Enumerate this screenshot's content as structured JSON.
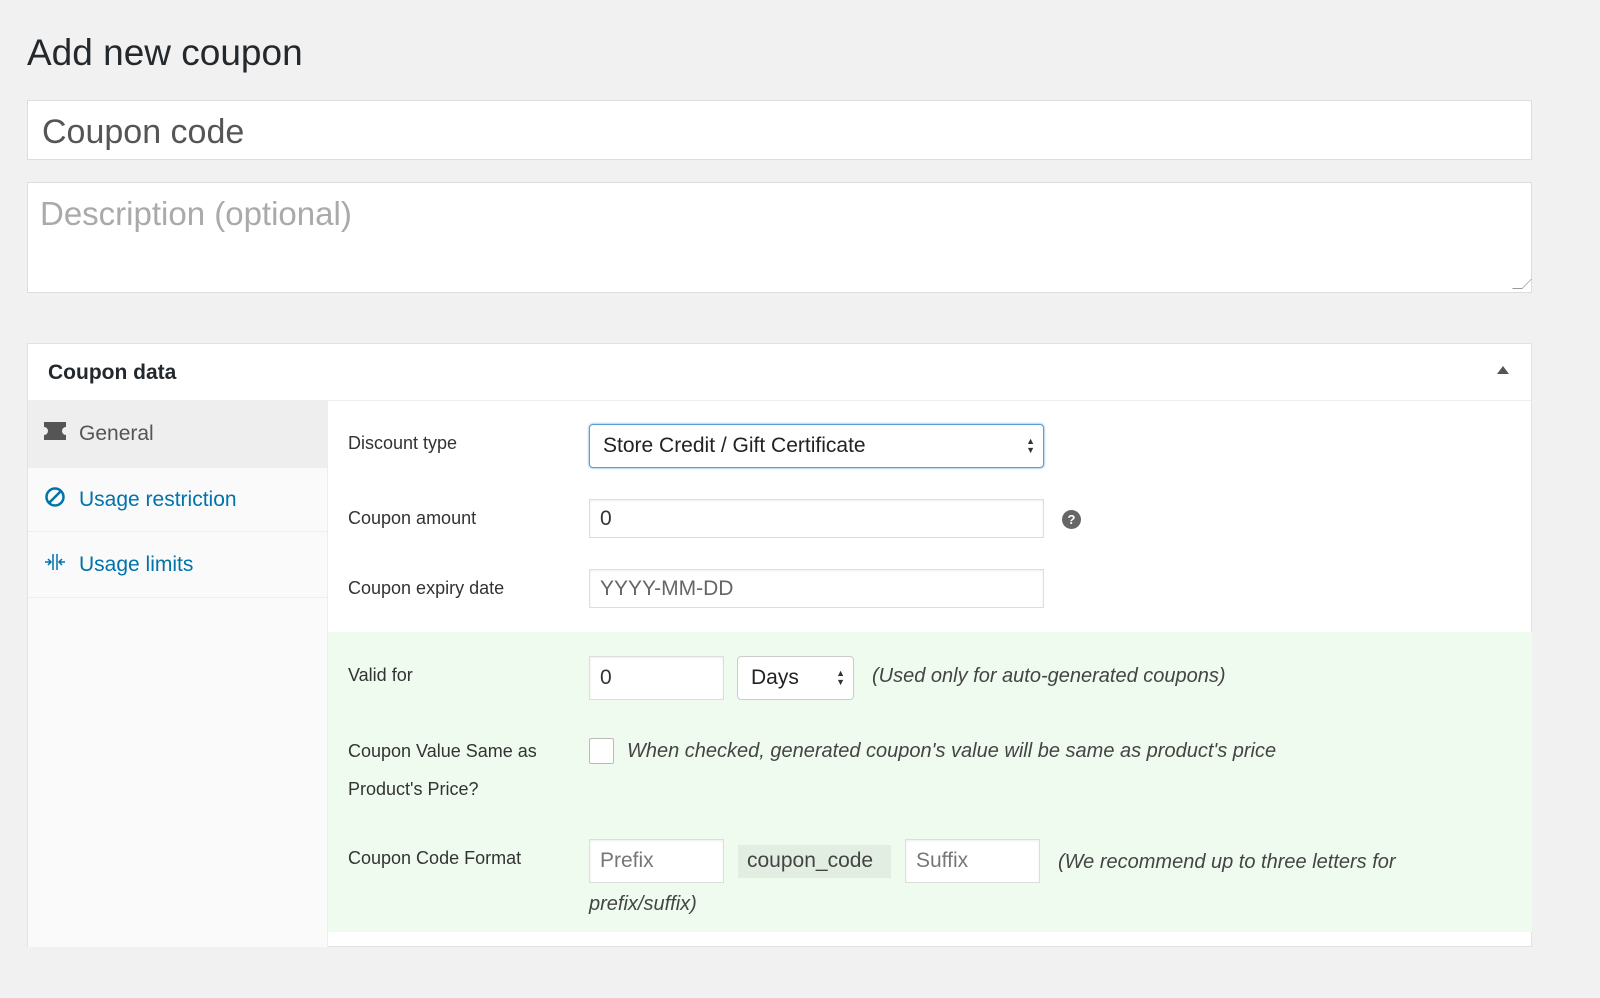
{
  "page": {
    "title": "Add new coupon",
    "coupon_code_placeholder": "Coupon code",
    "description_placeholder": "Description (optional)"
  },
  "panel": {
    "title": "Coupon data",
    "tabs": [
      {
        "label": "General",
        "icon": "ticket-icon",
        "active": true
      },
      {
        "label": "Usage restriction",
        "icon": "block-icon"
      },
      {
        "label": "Usage limits",
        "icon": "limits-icon"
      }
    ],
    "fields": {
      "discount_type": {
        "label": "Discount type",
        "value": "Store Credit / Gift Certificate"
      },
      "coupon_amount": {
        "label": "Coupon amount",
        "value": "0"
      },
      "expiry": {
        "label": "Coupon expiry date",
        "placeholder": "YYYY-MM-DD"
      },
      "valid_for": {
        "label": "Valid for",
        "value": "0",
        "unit": "Days",
        "note": "(Used only for auto-generated coupons)"
      },
      "same_price": {
        "label_1": "Coupon Value Same as",
        "label_2": "Product's Price?",
        "checked": false,
        "note": "When checked, generated coupon's value will be same as product's price"
      },
      "code_format": {
        "label": "Coupon Code Format",
        "prefix_placeholder": "Prefix",
        "code": "coupon_code",
        "suffix_placeholder": "Suffix",
        "note_1": "(We recommend up to three letters for",
        "note_2": "prefix/suffix)"
      }
    }
  },
  "colors": {
    "accent": "#0073aa",
    "highlight_bg": "#effbef",
    "select_border": "#5b9dd9"
  }
}
